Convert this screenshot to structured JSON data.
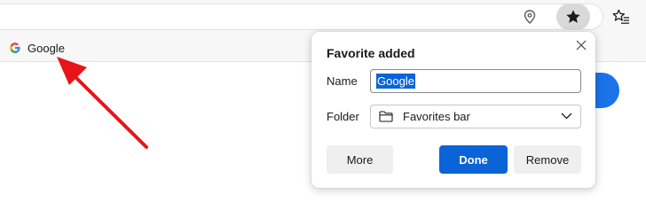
{
  "bookmarks_bar": {
    "items": [
      {
        "label": "Google",
        "icon": "google-g-icon"
      }
    ]
  },
  "toolbar": {
    "location_icon": "location-icon",
    "favorite_icon": "star-filled-icon",
    "favorites_icon": "favorites-list-icon"
  },
  "popup": {
    "title": "Favorite added",
    "name_label": "Name",
    "name_value": "Google",
    "folder_label": "Folder",
    "folder_value": "Favorites bar",
    "more_label": "More",
    "done_label": "Done",
    "remove_label": "Remove"
  },
  "colors": {
    "accent": "#0a64d8",
    "arrow": "#e8141a"
  }
}
